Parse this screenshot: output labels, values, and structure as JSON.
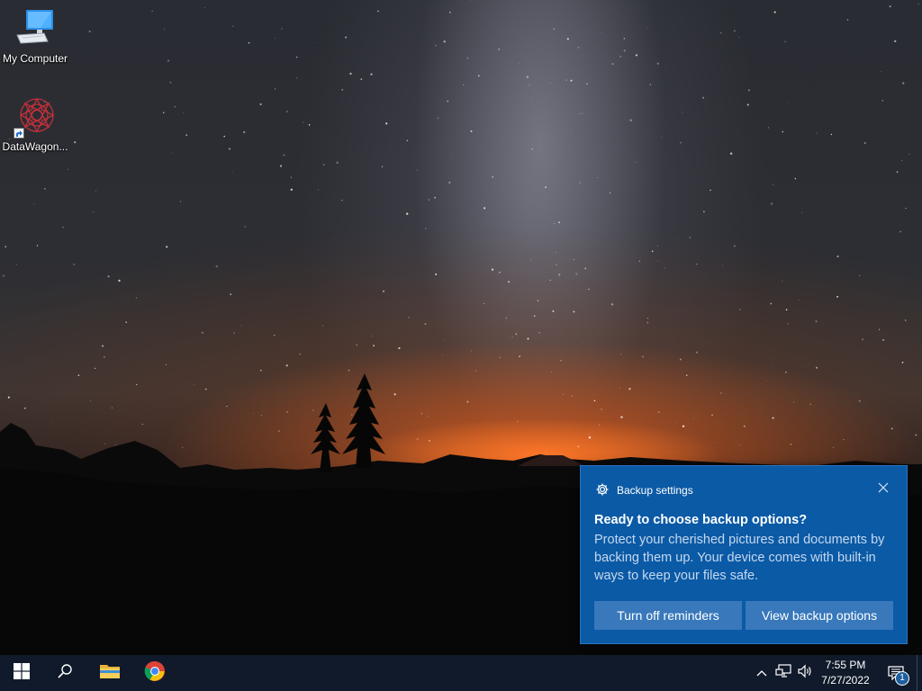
{
  "desktop": {
    "icons": [
      {
        "label": "My Computer",
        "icon": "computer-icon"
      },
      {
        "label": "DataWagon...",
        "icon": "datawagon-icon"
      }
    ]
  },
  "toast": {
    "app_name": "Backup settings",
    "app_icon": "gear-icon",
    "title": "Ready to choose backup options?",
    "body": "Protect your cherished pictures and documents by backing them up. Your device comes with built-in ways to keep your files safe.",
    "button_left": "Turn off reminders",
    "button_right": "View backup options",
    "close_icon": "close-icon",
    "background_color": "#0b5aa6",
    "button_color": "#3878bb"
  },
  "taskbar": {
    "background_color": "#101a2a",
    "pinned": [
      {
        "name": "start",
        "icon": "windows-logo-icon"
      },
      {
        "name": "search",
        "icon": "search-icon"
      },
      {
        "name": "file-explorer",
        "icon": "folder-icon"
      },
      {
        "name": "chrome",
        "icon": "chrome-icon"
      }
    ],
    "tray": {
      "icons": [
        "chevron-up-icon",
        "network-icon",
        "volume-icon"
      ],
      "time": "7:55 PM",
      "date": "7/27/2022",
      "notification_count": "1"
    }
  }
}
